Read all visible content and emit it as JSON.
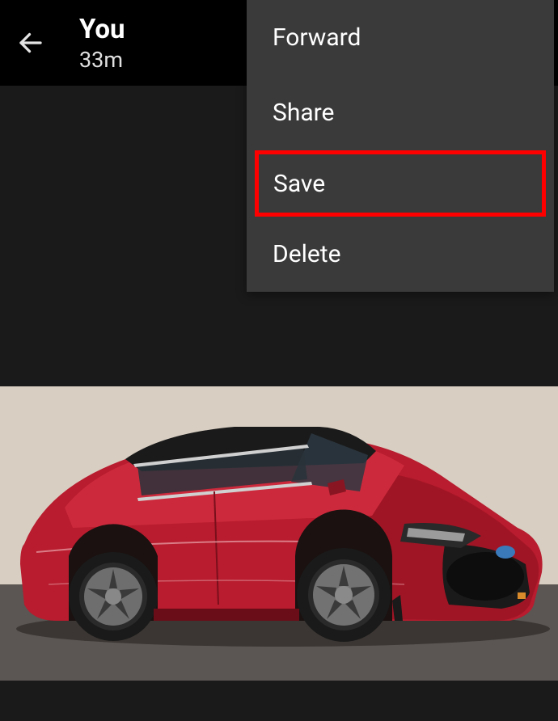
{
  "header": {
    "sender": "You",
    "timestamp": "33m"
  },
  "menu": {
    "items": [
      {
        "label": "Forward",
        "highlighted": false
      },
      {
        "label": "Share",
        "highlighted": false
      },
      {
        "label": "Save",
        "highlighted": true
      },
      {
        "label": "Delete",
        "highlighted": false
      }
    ]
  }
}
